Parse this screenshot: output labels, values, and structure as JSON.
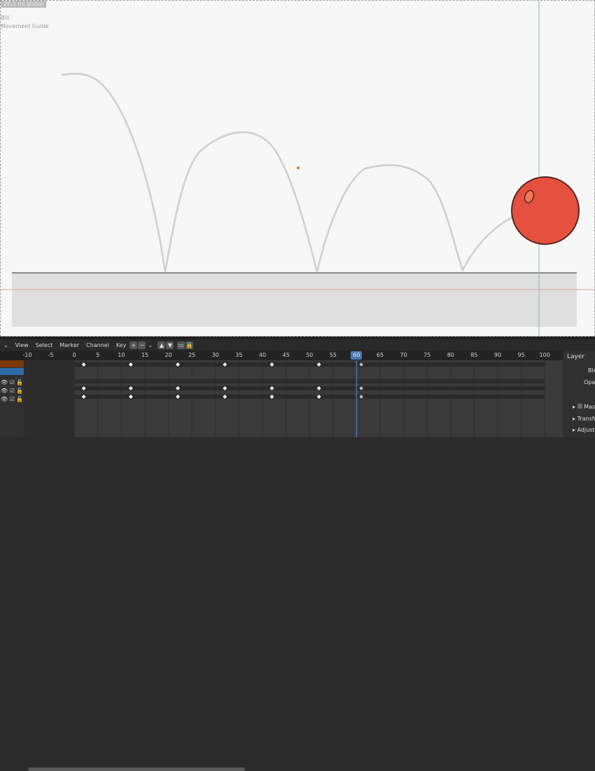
{
  "viewport": {
    "overlay_top": "26.5 ml global",
    "overlay_line1": "Bill",
    "overlay_line2": "Movement Guide"
  },
  "colors": {
    "ball_fill": "#e5513e",
    "ball_stroke": "#5a2420",
    "path_stroke": "#cfcfcf",
    "ground_fill": "#dfdfdf",
    "playhead": "#4a78b8",
    "keyframe": "#ffffff"
  },
  "timeline": {
    "menu": [
      "View",
      "Select",
      "Marker",
      "Channel",
      "Key"
    ],
    "icons": [
      "dropdown-icon",
      "swap-icon",
      "plus-icon",
      "minus-icon",
      "chevron-down-icon",
      "triangle-up-icon",
      "triangle-down-icon",
      "monitor-icon",
      "lock-icon"
    ],
    "ruler_ticks": [
      "-10",
      "-5",
      "0",
      "5",
      "10",
      "15",
      "20",
      "25",
      "30",
      "35",
      "40",
      "45",
      "50",
      "55",
      "60",
      "65",
      "70",
      "75",
      "80",
      "85",
      "90",
      "95",
      "100"
    ],
    "current_frame": "60",
    "keyframes": [
      2,
      12,
      22,
      32,
      42,
      52,
      61
    ]
  },
  "side_panel": {
    "title": "Layer",
    "blend": "Ble",
    "opacity": "Opac",
    "mask": "Mas",
    "transform": "Transfo",
    "adjust": "Adjust"
  }
}
